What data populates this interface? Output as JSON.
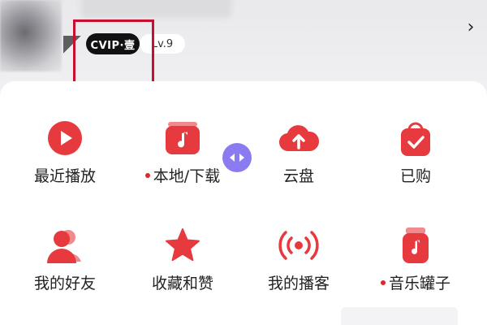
{
  "profile": {
    "vip_label": "CVIP·壹",
    "level_label": "Lv.9",
    "chevron": "›"
  },
  "colors": {
    "accent": "#e0262e",
    "highlight_box": "#c8102e",
    "float_button": "#8a7cf0"
  },
  "grid": {
    "row1": [
      {
        "label": "最近播放",
        "icon": "play-icon",
        "dot": false
      },
      {
        "label": "本地/下载",
        "icon": "music-folder-icon",
        "dot": true
      },
      {
        "label": "云盘",
        "icon": "cloud-upload-icon",
        "dot": false
      },
      {
        "label": "已购",
        "icon": "shopping-bag-icon",
        "dot": false
      }
    ],
    "row2": [
      {
        "label": "我的好友",
        "icon": "friends-icon",
        "dot": false
      },
      {
        "label": "收藏和赞",
        "icon": "star-icon",
        "dot": false
      },
      {
        "label": "我的播客",
        "icon": "podcast-icon",
        "dot": false
      },
      {
        "label": "音乐罐子",
        "icon": "music-jar-icon",
        "dot": true
      }
    ]
  },
  "float_button_icon": "expand-arrows-icon"
}
